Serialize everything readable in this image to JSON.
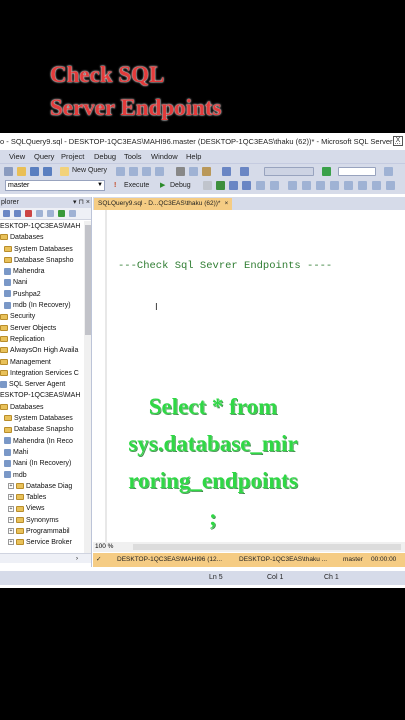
{
  "overlay": {
    "title_line1": "Check SQL",
    "title_line2": "Server Endpoints"
  },
  "window": {
    "title": "o - SQLQuery9.sql - DESKTOP-1QC3EAS\\MAHI96.master (DESKTOP-1QC3EAS\\thaku (62))* - Microsoft SQL Server ...",
    "close": "X"
  },
  "menu": [
    "View",
    "Query",
    "Project",
    "Debug",
    "Tools",
    "Window",
    "Help"
  ],
  "toolbar": {
    "new_query": "New Query",
    "database": "master",
    "execute": "Execute",
    "debug": "Debug"
  },
  "explorer": {
    "title": "plorer",
    "pin": "▾ ⊓ ×",
    "items": [
      {
        "label": "ESKTOP-1QC3EAS\\MAH",
        "icon": "server"
      },
      {
        "label": "Databases",
        "icon": "folder"
      },
      {
        "label": "System Databases",
        "icon": "folder"
      },
      {
        "label": "Database Snapsho",
        "icon": "folder"
      },
      {
        "label": "Mahendra",
        "icon": "db"
      },
      {
        "label": "Nani",
        "icon": "db"
      },
      {
        "label": "Pushpa2",
        "icon": "db"
      },
      {
        "label": "mdb (In Recovery)",
        "icon": "db"
      },
      {
        "label": "Security",
        "icon": "folder"
      },
      {
        "label": "Server Objects",
        "icon": "folder"
      },
      {
        "label": "Replication",
        "icon": "folder"
      },
      {
        "label": "AlwaysOn High Availa",
        "icon": "folder"
      },
      {
        "label": "Management",
        "icon": "folder"
      },
      {
        "label": "Integration Services C",
        "icon": "folder"
      },
      {
        "label": "SQL Server Agent",
        "icon": "agent"
      },
      {
        "label": "ESKTOP-1QC3EAS\\MAH",
        "icon": "server"
      },
      {
        "label": "Databases",
        "icon": "folder"
      },
      {
        "label": "System Databases",
        "icon": "folder"
      },
      {
        "label": "Database Snapsho",
        "icon": "folder"
      },
      {
        "label": "Mahendra (In Reco",
        "icon": "db"
      },
      {
        "label": "Mahi",
        "icon": "db"
      },
      {
        "label": "Nani (In Recovery)",
        "icon": "db"
      },
      {
        "label": "mdb",
        "icon": "db"
      },
      {
        "label": "Database Diag",
        "icon": "folder"
      },
      {
        "label": "Tables",
        "icon": "folder"
      },
      {
        "label": "Views",
        "icon": "folder"
      },
      {
        "label": "Synonyms",
        "icon": "folder"
      },
      {
        "label": "Programmabil",
        "icon": "folder"
      },
      {
        "label": "Service Broker",
        "icon": "folder"
      }
    ]
  },
  "editor": {
    "tab_label": "SQLQuery9.sql - D...QC3EAS\\thaku (62))*",
    "tab_close": "×",
    "comment": "---Check Sql Sevrer Endpoints ----",
    "zoom": "100 %"
  },
  "caption": {
    "line1": "Select * from",
    "line2": "sys.database_mir",
    "line3": "roring_endpoints",
    "line4": ";"
  },
  "connection": {
    "server": "DESKTOP-1QC3EAS\\MAHI96 (12...",
    "user": "DESKTOP-1QC3EAS\\thaku ...",
    "db": "master",
    "time": "00:00:00"
  },
  "status": {
    "ln": "Ln 5",
    "col": "Col 1",
    "ch": "Ch 1"
  }
}
